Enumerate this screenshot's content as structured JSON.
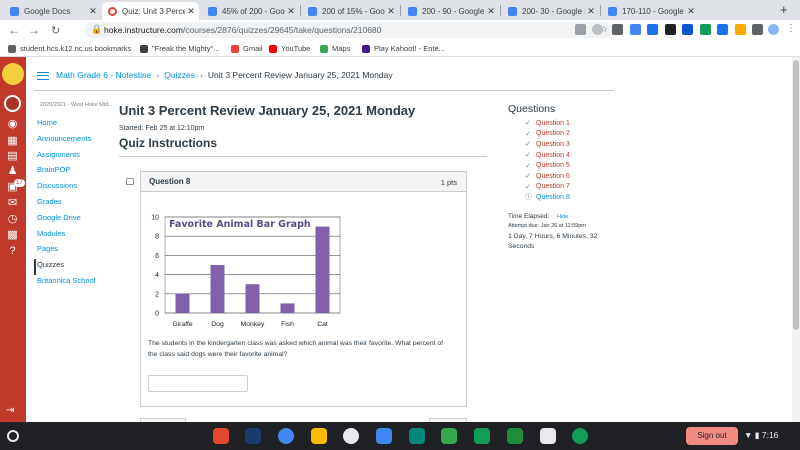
{
  "browser": {
    "tabs": [
      {
        "title": "Google Docs",
        "favicon_color": "#4285f4",
        "active": false
      },
      {
        "title": "Quiz: Unit 3 Percent",
        "favicon_color": "#e4472f",
        "active": true
      },
      {
        "title": "45% of 200 - Google",
        "favicon_color": "#4285f4",
        "active": false
      },
      {
        "title": "200 of 15% - Google",
        "favicon_color": "#4285f4",
        "active": false
      },
      {
        "title": "200 - 90 - Google S",
        "favicon_color": "#4285f4",
        "active": false
      },
      {
        "title": "200- 30 - Google Se",
        "favicon_color": "#4285f4",
        "active": false
      },
      {
        "title": "170-110 - Google Se",
        "favicon_color": "#4285f4",
        "active": false
      }
    ],
    "url_host": "hoke.instructure.com",
    "url_path": "/courses/2876/quizzes/29645/take/questions/210680",
    "bookmarks": [
      {
        "label": "student.hcs.k12.nc.us bookmarks",
        "icon_color": "#5f6368"
      },
      {
        "label": "\"Freak the Mighty\"...",
        "icon_color": "#3c4043"
      },
      {
        "label": "Gmail",
        "icon_color": "#ea4335"
      },
      {
        "label": "YouTube",
        "icon_color": "#ff0000"
      },
      {
        "label": "Maps",
        "icon_color": "#34a853"
      },
      {
        "label": "Play Kahoot! - Ente...",
        "icon_color": "#46178f"
      }
    ]
  },
  "breadcrumb": {
    "course": "Math Grade 6 - Notestine",
    "section": "Quizzes",
    "current": "Unit 3 Percent Review January 25, 2021 Monday"
  },
  "course_nav": {
    "term": "2020/2021 - West Hoke Mid...",
    "items": [
      "Home",
      "Announcements",
      "Assignments",
      "BrainPOP",
      "Discussions",
      "Grades",
      "Google Drive",
      "Modules",
      "Pages",
      "Quizzes",
      "Britannica School"
    ],
    "active_index": 9
  },
  "quiz": {
    "title": "Unit 3 Percent Review January 25, 2021 Monday",
    "started": "Started: Feb 25 at 12:10pm",
    "instructions_heading": "Quiz Instructions"
  },
  "question": {
    "name": "Question 8",
    "points": "1 pts",
    "text": "The students in the kindergarten class was asked which animal was their favorite. What percent of the class said dogs were their favorite animal?",
    "answer_value": ""
  },
  "chart_data": {
    "type": "bar",
    "title": "Favorite Animal Bar Graph",
    "categories": [
      "Giraffe",
      "Dog",
      "Monkey",
      "Fish",
      "Cat"
    ],
    "values": [
      2,
      5,
      3,
      1,
      9
    ],
    "ylim": [
      0,
      10
    ],
    "yticks": [
      0,
      2,
      4,
      6,
      8,
      10
    ],
    "bar_color": "#8060a8",
    "grid": true
  },
  "sidebar": {
    "heading": "Questions",
    "questions": [
      {
        "label": "Question 1",
        "state": "answered"
      },
      {
        "label": "Question 2",
        "state": "answered"
      },
      {
        "label": "Question 3",
        "state": "answered"
      },
      {
        "label": "Question 4",
        "state": "answered"
      },
      {
        "label": "Question 5",
        "state": "answered"
      },
      {
        "label": "Question 6",
        "state": "answered"
      },
      {
        "label": "Question 7",
        "state": "answered"
      },
      {
        "label": "Question 8",
        "state": "current"
      }
    ],
    "time_elapsed_label": "Time Elapsed:",
    "hide_label": "Hide",
    "attempt_due": "Attempt due: Jan 26 at 11:59pm",
    "elapsed_value": "1 Day, 7 Hours, 6 Minutes, 32 Seconds"
  },
  "shelf": {
    "sign_out": "Sign out",
    "time": "7:16",
    "apps": [
      {
        "name": "canvas-app",
        "color": "#e4472f"
      },
      {
        "name": "pear-deck-app",
        "color": "#1b3a6b"
      },
      {
        "name": "chrome-app",
        "color": "#4285f4"
      },
      {
        "name": "keep-app",
        "color": "#fbbc04"
      },
      {
        "name": "kami-app",
        "color": "#e8eaed"
      },
      {
        "name": "docs-app",
        "color": "#4285f4"
      },
      {
        "name": "meet-app",
        "color": "#00897b"
      },
      {
        "name": "drive-app",
        "color": "#34a853"
      },
      {
        "name": "sheets-app",
        "color": "#0f9d58"
      },
      {
        "name": "classroom-app",
        "color": "#1e8e3e"
      },
      {
        "name": "turtle-app",
        "color": "#e8eaed"
      },
      {
        "name": "hangouts-app",
        "color": "#0f9d58"
      }
    ]
  }
}
